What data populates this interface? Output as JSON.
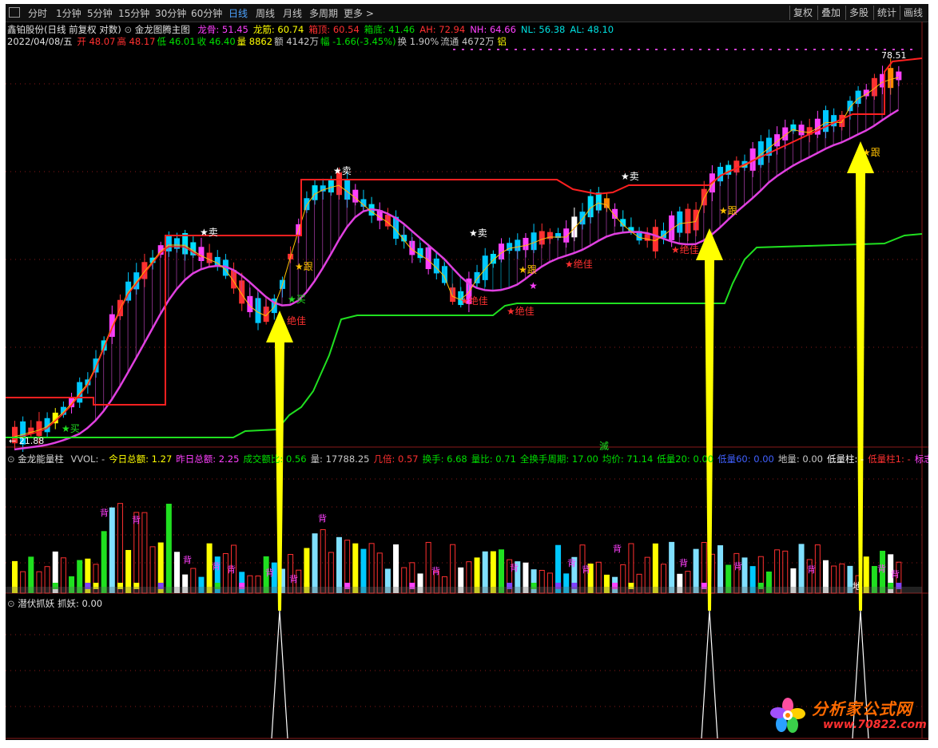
{
  "toolbar": {
    "tabs": [
      "分时",
      "1分钟",
      "5分钟",
      "15分钟",
      "30分钟",
      "60分钟",
      "日线",
      "周线",
      "月线",
      "多周期",
      "更多 >"
    ],
    "active_tab": "日线",
    "right_buttons": [
      "复权",
      "叠加",
      "多股",
      "统计",
      "画线"
    ]
  },
  "header": {
    "stock_name": "鑫铂股份",
    "mode": "(日线 前复权 对数)",
    "indicator_name": "金龙图腾主图",
    "pairs": [
      {
        "label": "龙骨:",
        "value": "51.45",
        "color": "#ff40ff"
      },
      {
        "label": "龙筋:",
        "value": "60.74",
        "color": "#ffff00"
      },
      {
        "label": "箱顶:",
        "value": "60.54",
        "color": "#ff3030"
      },
      {
        "label": "箱底:",
        "value": "41.46",
        "color": "#00e000"
      },
      {
        "label": "AH:",
        "value": "72.94",
        "color": "#ff3030"
      },
      {
        "label": "NH:",
        "value": "64.66",
        "color": "#ff40ff"
      },
      {
        "label": "NL:",
        "value": "56.38",
        "color": "#00e0e0"
      },
      {
        "label": "AL:",
        "value": "48.10",
        "color": "#00e0e0"
      }
    ],
    "date": "2022/04/08/五",
    "ohlc": [
      {
        "label": "开",
        "value": "48.07",
        "color": "#ff3030"
      },
      {
        "label": "高",
        "value": "48.17",
        "color": "#ff3030"
      },
      {
        "label": "低",
        "value": "46.01",
        "color": "#00e000"
      },
      {
        "label": "收",
        "value": "46.40",
        "color": "#00e000"
      },
      {
        "label": "量",
        "value": "8862",
        "color": "#ffff00"
      },
      {
        "label": "额",
        "value": "4142万",
        "color": "#c8c8c8"
      },
      {
        "label": "幅",
        "value": "-1.66(-3.45%)",
        "color": "#00e000"
      },
      {
        "label": "换",
        "value": "1.90%",
        "color": "#c8c8c8"
      },
      {
        "label": "流通",
        "value": "4672万",
        "color": "#c8c8c8"
      }
    ],
    "tag": "铝"
  },
  "main_chart": {
    "price_high_label": "78.51",
    "price_low_label": "21.88",
    "labels": {
      "sell": "★卖",
      "buy": "★买",
      "follow": "★跟",
      "best": "★绝佳",
      "best_plain": "绝佳",
      "star": "★",
      "extinguish": "滅"
    }
  },
  "volume_panel": {
    "title": "金龙能量柱",
    "pairs": [
      {
        "label": "VVOL:",
        "value": "-",
        "color": "#c8c8c8"
      },
      {
        "label": "今日总额:",
        "value": "1.27",
        "color": "#ffff00"
      },
      {
        "label": "昨日总额:",
        "value": "2.25",
        "color": "#ff40ff"
      },
      {
        "label": "成交额比:",
        "value": "0.56",
        "color": "#00e000"
      },
      {
        "label": "量:",
        "value": "17788.25",
        "color": "#c8c8c8"
      },
      {
        "label": "几倍:",
        "value": "0.57",
        "color": "#ff3030"
      },
      {
        "label": "换手:",
        "value": "6.68",
        "color": "#00e000"
      },
      {
        "label": "量比:",
        "value": "0.71",
        "color": "#00e000"
      },
      {
        "label": "全换手周期:",
        "value": "17.00",
        "color": "#00e000"
      },
      {
        "label": "均价:",
        "value": "71.14",
        "color": "#00e000"
      },
      {
        "label": "低量20:",
        "value": "0.00",
        "color": "#00e000"
      },
      {
        "label": "低量60:",
        "value": "0.00",
        "color": "#4060ff"
      },
      {
        "label": "地量:",
        "value": "0.00",
        "color": "#c8c8c8"
      },
      {
        "label": "低量柱:",
        "value": "-",
        "color": "#ffffff"
      },
      {
        "label": "低量柱1:",
        "value": "-",
        "color": "#ff3030"
      },
      {
        "label": "标志线",
        "value": "",
        "color": "#ff40ff"
      }
    ],
    "divergence_label": "背",
    "ground_label": "地"
  },
  "bottom_panel": {
    "title": "潜伏抓妖",
    "label": "抓妖:",
    "value": "0.00"
  },
  "watermark": {
    "name": "分析家公式网",
    "url": "www.70822.com"
  },
  "colors": {
    "up": "#ff3030",
    "down": "#00e0ff",
    "magenta": "#ff40ff",
    "green": "#00e000",
    "yellow": "#ffff00",
    "arrow": "#ffff00"
  }
}
